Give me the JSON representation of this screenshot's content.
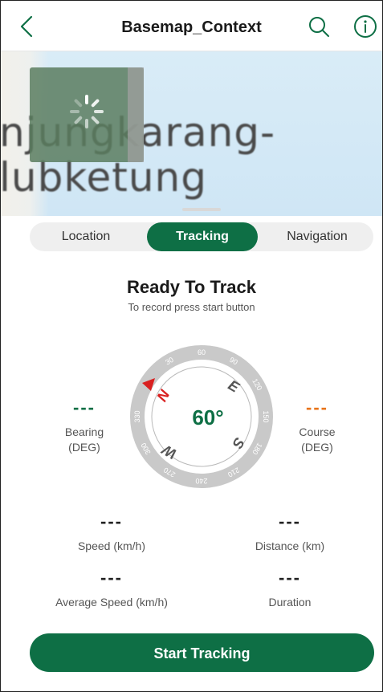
{
  "header": {
    "title": "Basemap_Context",
    "back_icon": "chevron-left-icon",
    "search_icon": "search-icon",
    "info_icon": "info-icon"
  },
  "map": {
    "label_line1": "njungkarang-",
    "label_line2": "lubketung"
  },
  "tabs": [
    {
      "label": "Location",
      "active": false
    },
    {
      "label": "Tracking",
      "active": true
    },
    {
      "label": "Navigation",
      "active": false
    }
  ],
  "status": {
    "title": "Ready To Track",
    "hint": "To record press start button"
  },
  "compass": {
    "center_value": "60°",
    "cardinals": [
      "N",
      "E",
      "S",
      "W"
    ],
    "ticks": [
      "30",
      "60",
      "90",
      "120",
      "150",
      "180",
      "210",
      "240",
      "270",
      "300",
      "330"
    ]
  },
  "bearing": {
    "value": "---",
    "label_line1": "Bearing",
    "label_line2": "(DEG)"
  },
  "course": {
    "value": "---",
    "label_line1": "Course",
    "label_line2": "(DEG)"
  },
  "speed": {
    "value": "---",
    "label": "Speed (km/h)"
  },
  "distance": {
    "value": "---",
    "label": "Distance (km)"
  },
  "avg_speed": {
    "value": "---",
    "label": "Average Speed (km/h)"
  },
  "duration": {
    "value": "---",
    "label": "Duration"
  },
  "start_button": {
    "label": "Start Tracking"
  },
  "colors": {
    "brand_green": "#0e6f45",
    "course_orange": "#e8731a",
    "north_red": "#d92020"
  }
}
